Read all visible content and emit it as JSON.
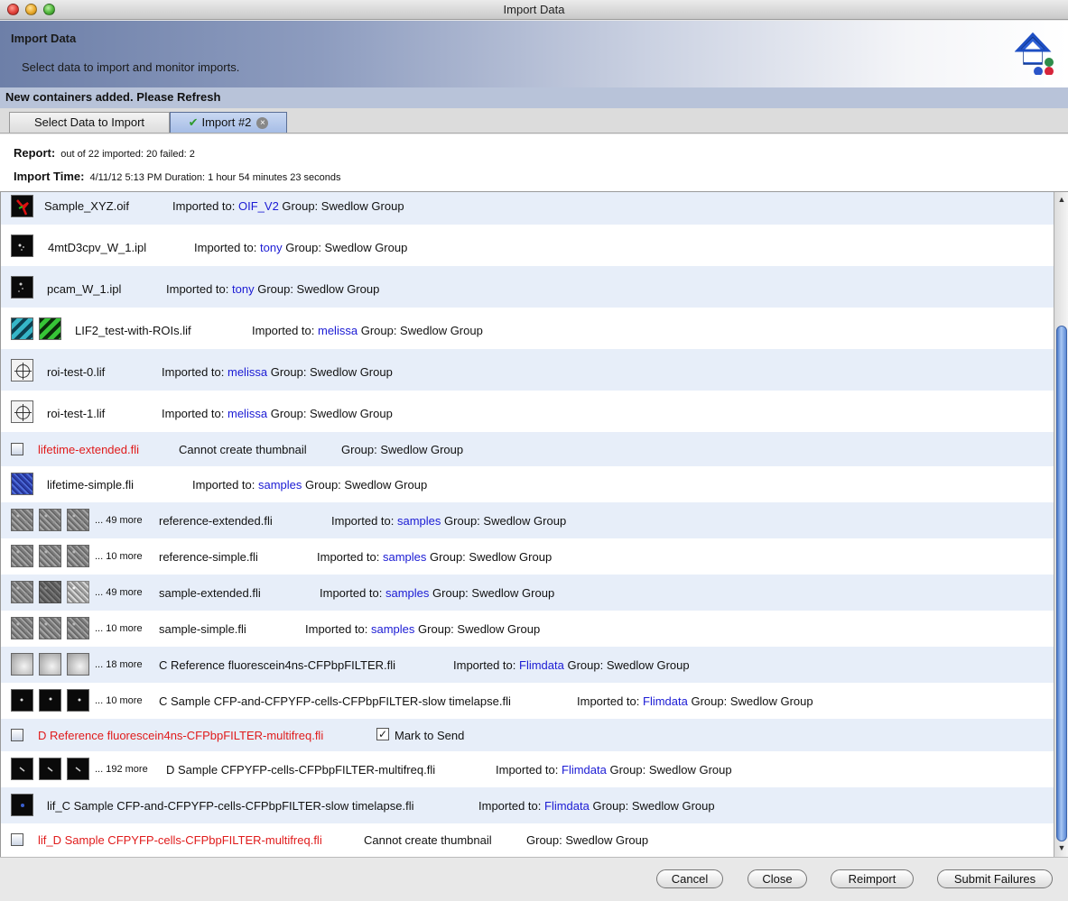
{
  "window": {
    "title": "Import Data"
  },
  "banner": {
    "title": "Import Data",
    "description": "Select data to import and monitor imports.",
    "notice": "New containers added. Please Refresh"
  },
  "tabs": [
    {
      "label": "Select Data to Import",
      "active": false
    },
    {
      "label": "Import #2",
      "active": true
    }
  ],
  "report": {
    "report_label": "Report:",
    "report_text": "out of 22 imported: 20 failed: 2",
    "time_label": "Import Time:",
    "time_text": "4/11/12 5:13 PM Duration: 1 hour 54 minutes 23 seconds"
  },
  "labels": {
    "imported_to": "Imported to:",
    "group": "Group: Swedlow Group",
    "cannot_thumb": "Cannot create thumbnail",
    "mark_to_send": "Mark to Send"
  },
  "rows": [
    {
      "file": "Sample_XYZ.oif",
      "dataset": "OIF_V2",
      "status": "ok"
    },
    {
      "file": "4mtD3cpv_W_1.ipl",
      "dataset": "tony",
      "status": "ok"
    },
    {
      "file": "pcam_W_1.ipl",
      "dataset": "tony",
      "status": "ok"
    },
    {
      "file": "LIF2_test-with-ROIs.lif",
      "dataset": "melissa",
      "status": "ok"
    },
    {
      "file": "roi-test-0.lif",
      "dataset": "melissa",
      "status": "ok"
    },
    {
      "file": "roi-test-1.lif",
      "dataset": "melissa",
      "status": "ok"
    },
    {
      "file": "lifetime-extended.fli",
      "status": "failed"
    },
    {
      "file": "lifetime-simple.fli",
      "dataset": "samples",
      "status": "ok"
    },
    {
      "file": "reference-extended.fli",
      "dataset": "samples",
      "more": "... 49 more",
      "status": "ok"
    },
    {
      "file": "reference-simple.fli",
      "dataset": "samples",
      "more": "... 10 more",
      "status": "ok"
    },
    {
      "file": "sample-extended.fli",
      "dataset": "samples",
      "more": "... 49 more",
      "status": "ok"
    },
    {
      "file": "sample-simple.fli",
      "dataset": "samples",
      "more": "... 10 more",
      "status": "ok"
    },
    {
      "file": "C Reference fluorescein4ns-CFPbpFILTER.fli",
      "dataset": "Flimdata",
      "more": "... 18 more",
      "status": "ok"
    },
    {
      "file": "C Sample CFP-and-CFPYFP-cells-CFPbpFILTER-slow timelapse.fli",
      "dataset": "Flimdata",
      "more": "... 10 more",
      "status": "ok"
    },
    {
      "file": "D Reference fluorescein4ns-CFPbpFILTER-multifreq.fli",
      "status": "failed-send",
      "mark_to_send": true
    },
    {
      "file": "D Sample CFPYFP-cells-CFPbpFILTER-multifreq.fli",
      "dataset": "Flimdata",
      "more": "... 192 more",
      "status": "ok"
    },
    {
      "file": "lif_C Sample CFP-and-CFPYFP-cells-CFPbpFILTER-slow timelapse.fli",
      "dataset": "Flimdata",
      "status": "ok"
    },
    {
      "file": "lif_D Sample CFPYFP-cells-CFPbpFILTER-multifreq.fli",
      "status": "failed"
    }
  ],
  "buttons": {
    "cancel": "Cancel",
    "close": "Close",
    "reimport": "Reimport",
    "submit_failures": "Submit Failures"
  },
  "colors": {
    "link": "#1b1bd4",
    "error": "#e01b1b",
    "alt_row": "#e7eef9"
  }
}
